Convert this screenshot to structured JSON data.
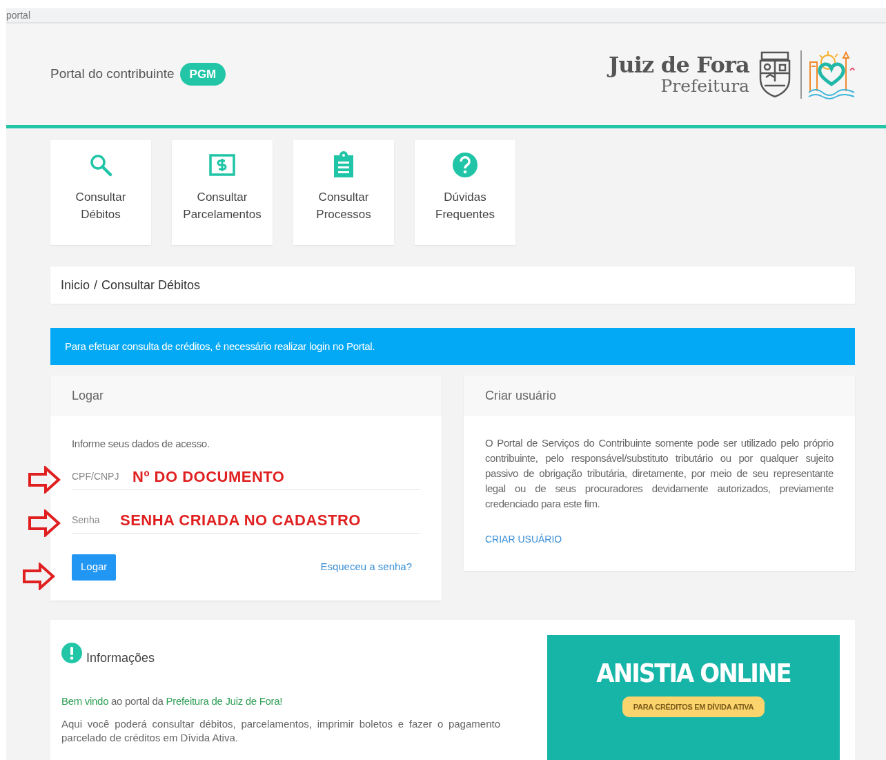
{
  "browser_strip": {
    "text": "portal"
  },
  "header": {
    "title": "Portal do contribuinte",
    "badge": "PGM",
    "logo": {
      "name": "Juiz de Fora",
      "subtitle": "Prefeitura"
    }
  },
  "shortcuts": [
    {
      "kind": "search",
      "label": "Consultar\nDébitos"
    },
    {
      "kind": "money",
      "label": "Consultar\nParcelamentos"
    },
    {
      "kind": "clipboard",
      "label": "Consultar\nProcessos"
    },
    {
      "kind": "help",
      "label": "Dúvidas\nFrequentes"
    }
  ],
  "breadcrumb": {
    "items": [
      "Inicio",
      "Consultar Débitos"
    ],
    "separator": "/"
  },
  "alert": "Para efetuar consulta de créditos, é necessário realizar login no Portal.",
  "login": {
    "title": "Logar",
    "intro": "Informe seus dados de acesso.",
    "fields": [
      {
        "placeholder": "CPF/CNPJ",
        "annotation": "Nº DO DOCUMENTO",
        "annotated": true
      },
      {
        "placeholder": "Senha",
        "annotation": "SENHA CRIADA NO CADASTRO",
        "annotated": true
      }
    ],
    "button": {
      "label": "Logar",
      "annotated": true
    },
    "link": "Esqueceu a senha?"
  },
  "signup": {
    "title": "Criar usuário",
    "text": "O Portal de Serviços do Contribuinte somente pode ser utilizado pelo próprio contribuinte, pelo responsável/substituto tributário ou por qualquer sujeito passivo de obrigação tributária, diretamente, por meio de seu representante legal ou de seus procuradores devidamente autorizados, previamente credenciado para este fim.",
    "link": "CRIAR USUÁRIO"
  },
  "info": {
    "title": "Informações",
    "welcome": "**Bem vindo** ao portal da **Prefeitura de Juiz de Fora!**",
    "text": "Aqui você poderá consultar débitos, parcelamentos, imprimir boletos e fazer o pagamento parcelado de créditos em Dívida Ativa.",
    "banner": {
      "title": "ANISTIA ONLINE",
      "tag": "PARA CRÉDITOS EM DÍVIDA ATIVA"
    }
  }
}
